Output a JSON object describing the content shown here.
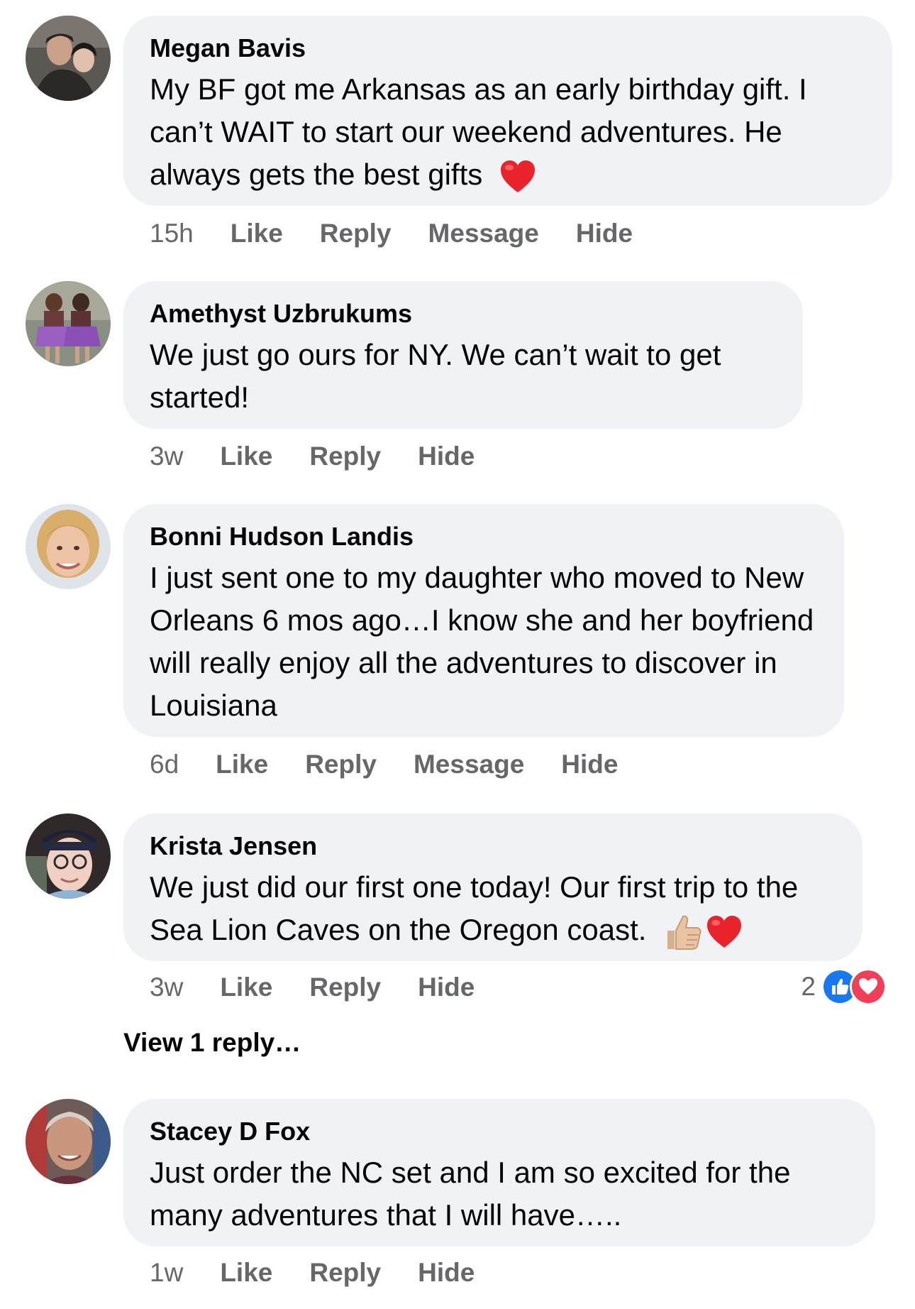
{
  "comments": [
    {
      "author": "Megan Bavis",
      "text": "My BF got me Arkansas as an early birthday gift. I can’t WAIT to start our weekend adventures. He always gets the best gifts",
      "time": "15h",
      "actions": [
        "Like",
        "Reply",
        "Message",
        "Hide"
      ]
    },
    {
      "author": "Amethyst Uzbrukums",
      "text": "We just go ours for NY. We can’t wait to get started!",
      "time": "3w",
      "actions": [
        "Like",
        "Reply",
        "Hide"
      ]
    },
    {
      "author": "Bonni Hudson Landis",
      "text": "I just sent one to my daughter who moved to New Orleans 6 mos ago…I know she and her boyfriend will really enjoy all the adventures to discover in Louisiana",
      "time": "6d",
      "actions": [
        "Like",
        "Reply",
        "Message",
        "Hide"
      ]
    },
    {
      "author": "Krista Jensen",
      "text": "We just did our first one today! Our first trip to the Sea Lion Caves on the Oregon coast.",
      "time": "3w",
      "actions": [
        "Like",
        "Reply",
        "Hide"
      ],
      "reaction_count": "2",
      "view_replies": "View 1 reply…"
    },
    {
      "author": "Stacey D Fox",
      "text": "Just order the NC set and I am so excited for the many adventures that I will have…..",
      "time": "1w",
      "actions": [
        "Like",
        "Reply",
        "Hide"
      ]
    }
  ],
  "colors": {
    "bubble": "#f0f2f5",
    "meta_text": "#65676b",
    "like_blue": "#1877f2",
    "love_red": "#f33e58"
  },
  "icons": [
    "red-heart-emoji",
    "thumbs-up-emoji",
    "like-reaction-icon",
    "love-reaction-icon"
  ]
}
